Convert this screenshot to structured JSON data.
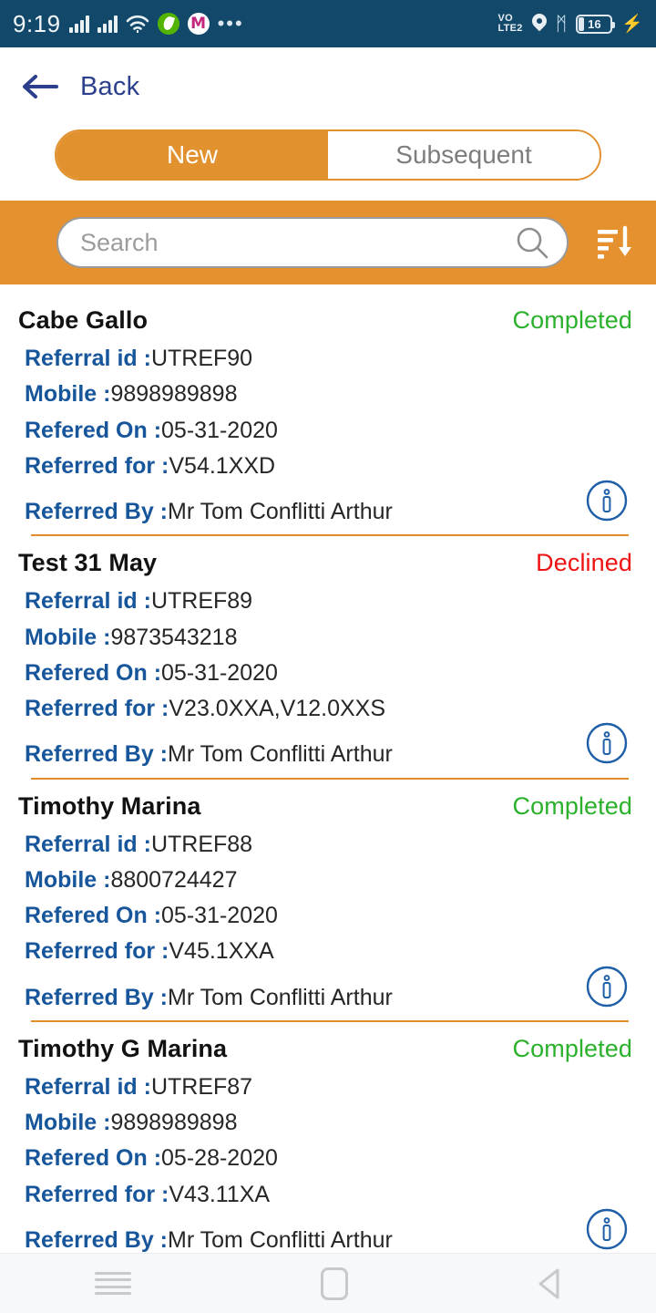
{
  "status_bar": {
    "time": "9:19",
    "signal_icon_1": "signal-bars-icon",
    "signal_icon_2": "signal-bars-icon",
    "wifi_icon": "wifi-icon",
    "app_icon_1": "green-droplet-app-icon",
    "app_icon_2": "m-app-icon",
    "app_icon_2_glyph": "M",
    "more_icon": "more-dots-icon",
    "volte_line1": "VO",
    "volte_line2": "LTE2",
    "location_icon": "location-pin-icon",
    "bluetooth_icon": "bluetooth-icon",
    "bluetooth_glyph": "ᛗ",
    "battery_level": "16",
    "charging_icon": "charging-bolt-icon",
    "charging_glyph": "⚡"
  },
  "header": {
    "back_label": "Back",
    "back_icon": "arrow-left-icon"
  },
  "segment": {
    "options": [
      {
        "label": "New",
        "selected": true
      },
      {
        "label": "Subsequent",
        "selected": false
      }
    ]
  },
  "search": {
    "placeholder": "Search",
    "value": "",
    "search_icon": "search-icon",
    "sort_icon": "sort-descending-icon"
  },
  "labels": {
    "referral_id": "Referral id :",
    "mobile": "Mobile :",
    "refered_on": "Refered On :",
    "referred_for": "Referred for :",
    "referred_by": "Referred By :",
    "info_icon": "info-icon"
  },
  "colors": {
    "accent_orange": "#e5912f",
    "header_navy": "#12496b",
    "label_blue": "#17569b",
    "back_blue": "#2b3f8c",
    "status_completed": "#2bb12b",
    "status_declined": "#ee1212",
    "divider_orange": "#e08b2c"
  },
  "referrals": [
    {
      "name": "Cabe Gallo",
      "status": "Completed",
      "status_type": "completed",
      "referral_id": "UTREF90",
      "mobile": "9898989898",
      "refered_on": "05-31-2020",
      "referred_for": "V54.1XXD",
      "referred_by": "Mr Tom Conflitti Arthur"
    },
    {
      "name": "Test 31 May",
      "status": "Declined",
      "status_type": "declined",
      "referral_id": "UTREF89",
      "mobile": "9873543218",
      "refered_on": "05-31-2020",
      "referred_for": "V23.0XXA,V12.0XXS",
      "referred_by": "Mr Tom Conflitti Arthur"
    },
    {
      "name": "Timothy Marina",
      "status": "Completed",
      "status_type": "completed",
      "referral_id": "UTREF88",
      "mobile": "8800724427",
      "refered_on": "05-31-2020",
      "referred_for": "V45.1XXA",
      "referred_by": "Mr Tom Conflitti Arthur"
    },
    {
      "name": "Timothy G Marina",
      "status": "Completed",
      "status_type": "completed",
      "referral_id": "UTREF87",
      "mobile": "9898989898",
      "refered_on": "05-28-2020",
      "referred_for": "V43.11XA",
      "referred_by": "Mr Tom Conflitti Arthur"
    }
  ],
  "navigation_bar": {
    "recents_icon": "recents-icon",
    "home_icon": "home-icon",
    "back_icon": "nav-back-icon"
  }
}
